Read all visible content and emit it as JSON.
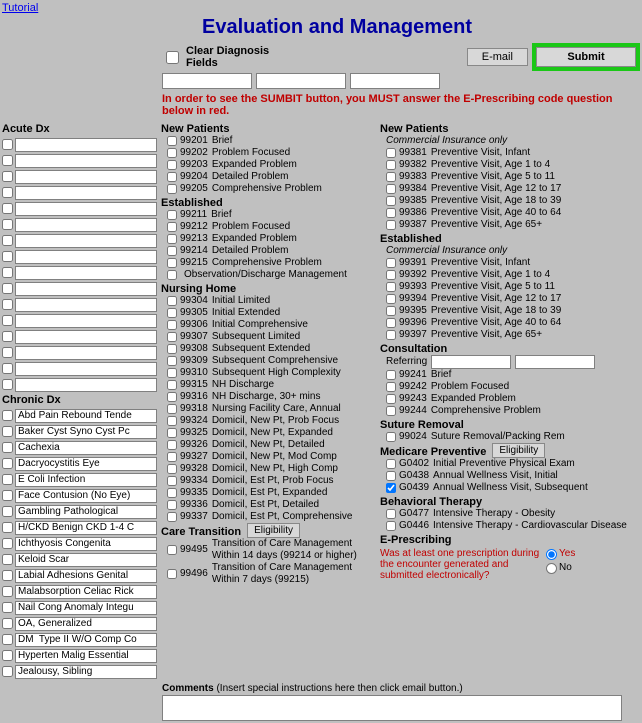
{
  "tutorial": "Tutorial",
  "title": "Evaluation and Management",
  "clear_label": "Clear Diagnosis Fields",
  "email_btn": "E-mail",
  "submit_btn": "Submit",
  "warning": "In order to see the SUMBIT button, you MUST answer the E-Prescribing code question below in red.",
  "acute_header": "Acute Dx",
  "chronic_header": "Chronic Dx",
  "chronic_dx": [
    "Abd Pain Rebound Tende",
    "Baker Cyst Syno Cyst Pc",
    "Cachexia",
    "Dacryocystitis Eye",
    "E Coli Infection",
    "Face Contusion (No Eye)",
    "Gambling Pathological",
    "H/CKD Benign CKD 1-4 C",
    "Ichthyosis Congenita",
    "Keloid Scar",
    "Labial Adhesions Genital",
    "Malabsorption Celiac Rick",
    "Nail Cong Anomaly Integu",
    "OA, Generalized",
    "DM  Type II W/O Comp Co",
    "Hyperten Malig Essential",
    "Jealousy, Sibling"
  ],
  "mid": {
    "new_patients": "New Patients",
    "np_codes": [
      {
        "c": "99201",
        "d": "Brief"
      },
      {
        "c": "99202",
        "d": "Problem Focused"
      },
      {
        "c": "99203",
        "d": "Expanded Problem"
      },
      {
        "c": "99204",
        "d": "Detailed Problem"
      },
      {
        "c": "99205",
        "d": "Comprehensive Problem"
      }
    ],
    "established": "Established",
    "est_codes": [
      {
        "c": "99211",
        "d": "Brief"
      },
      {
        "c": "99212",
        "d": "Problem Focused"
      },
      {
        "c": "99213",
        "d": "Expanded Problem"
      },
      {
        "c": "99214",
        "d": "Detailed Problem"
      },
      {
        "c": "99215",
        "d": "Comprehensive Problem"
      },
      {
        "c": "",
        "d": "Observation/Discharge Management"
      }
    ],
    "nursing": "Nursing Home",
    "nh_codes": [
      {
        "c": "99304",
        "d": "Initial Limited"
      },
      {
        "c": "99305",
        "d": "Initial Extended"
      },
      {
        "c": "99306",
        "d": "Initial Comprehensive"
      },
      {
        "c": "99307",
        "d": "Subsequent Limited"
      },
      {
        "c": "99308",
        "d": "Subsequent Extended"
      },
      {
        "c": "99309",
        "d": "Subsequent Comprehensive"
      },
      {
        "c": "99310",
        "d": "Subsequent High Complexity"
      },
      {
        "c": "99315",
        "d": "NH Discharge"
      },
      {
        "c": "99316",
        "d": "NH Discharge, 30+ mins"
      },
      {
        "c": "99318",
        "d": "Nursing Facility Care, Annual"
      },
      {
        "c": "99324",
        "d": "Domicil, New Pt, Prob Focus"
      },
      {
        "c": "99325",
        "d": "Domicil, New Pt, Expanded"
      },
      {
        "c": "99326",
        "d": "Domicil, New Pt, Detailed"
      },
      {
        "c": "99327",
        "d": "Domicil, New Pt, Mod Comp"
      },
      {
        "c": "99328",
        "d": "Domicil, New Pt, High Comp"
      },
      {
        "c": "99334",
        "d": "Domicil, Est Pt, Prob Focus"
      },
      {
        "c": "99335",
        "d": "Domicil, Est Pt, Expanded"
      },
      {
        "c": "99336",
        "d": "Domicil, Est Pt, Detailed"
      },
      {
        "c": "99337",
        "d": "Domicil, Est Pt, Comprehensive"
      }
    ],
    "care_trans": "Care Transition",
    "eligibility_btn": "Eligibility",
    "ct_codes": [
      {
        "c": "99495",
        "d": "Transition of Care Management Within 14 days (99214 or higher)"
      },
      {
        "c": "99496",
        "d": "Transition of Care Management Within 7 days (99215)"
      }
    ]
  },
  "right": {
    "new_patients": "New Patients",
    "commercial": "Commercial Insurance only",
    "np_codes": [
      {
        "c": "99381",
        "d": "Preventive Visit, Infant"
      },
      {
        "c": "99382",
        "d": "Preventive Visit, Age 1 to 4"
      },
      {
        "c": "99383",
        "d": "Preventive Visit, Age 5 to 11"
      },
      {
        "c": "99384",
        "d": "Preventive Visit, Age 12 to 17"
      },
      {
        "c": "99385",
        "d": "Preventive Visit, Age 18 to 39"
      },
      {
        "c": "99386",
        "d": "Preventive Visit, Age 40 to 64"
      },
      {
        "c": "99387",
        "d": "Preventive Visit, Age 65+"
      }
    ],
    "established": "Established",
    "est_codes": [
      {
        "c": "99391",
        "d": "Preventive Visit, Infant"
      },
      {
        "c": "99392",
        "d": "Preventive Visit, Age 1 to 4"
      },
      {
        "c": "99393",
        "d": "Preventive Visit, Age 5 to 11"
      },
      {
        "c": "99394",
        "d": "Preventive Visit, Age 12 to 17"
      },
      {
        "c": "99395",
        "d": "Preventive Visit, Age 18 to 39"
      },
      {
        "c": "99396",
        "d": "Preventive Visit, Age 40 to 64"
      },
      {
        "c": "99397",
        "d": "Preventive Visit, Age 65+"
      }
    ],
    "consultation": "Consultation",
    "referring": "Referring",
    "cons_codes": [
      {
        "c": "99241",
        "d": "Brief"
      },
      {
        "c": "99242",
        "d": "Problem Focused"
      },
      {
        "c": "99243",
        "d": "Expanded Problem"
      },
      {
        "c": "99244",
        "d": "Comprehensive Problem"
      }
    ],
    "suture": "Suture Removal",
    "suture_codes": [
      {
        "c": "99024",
        "d": "Suture Removal/Packing Rem"
      }
    ],
    "medicare": "Medicare Preventive",
    "eligibility_btn": "Eligibility",
    "mp_codes": [
      {
        "c": "G0402",
        "d": "Initial Preventive Physical Exam"
      },
      {
        "c": "G0438",
        "d": "Annual Wellness Visit, Initial"
      },
      {
        "c": "G0439",
        "d": "Annual Wellness Visit, Subsequent",
        "checked": true
      }
    ],
    "behavioral": "Behavioral Therapy",
    "bt_codes": [
      {
        "c": "G0477",
        "d": "Intensive Therapy - Obesity"
      },
      {
        "c": "G0446",
        "d": "Intensive Therapy - Cardiovascular Disease"
      }
    ],
    "epresc_header": "E-Prescribing",
    "epresc_question": "Was at least one prescription during the encounter generated and submitted electronically?",
    "yes": "Yes",
    "no": "No"
  },
  "comments_label": "Comments",
  "comments_hint": "(Insert special instructions here then click email button.)"
}
